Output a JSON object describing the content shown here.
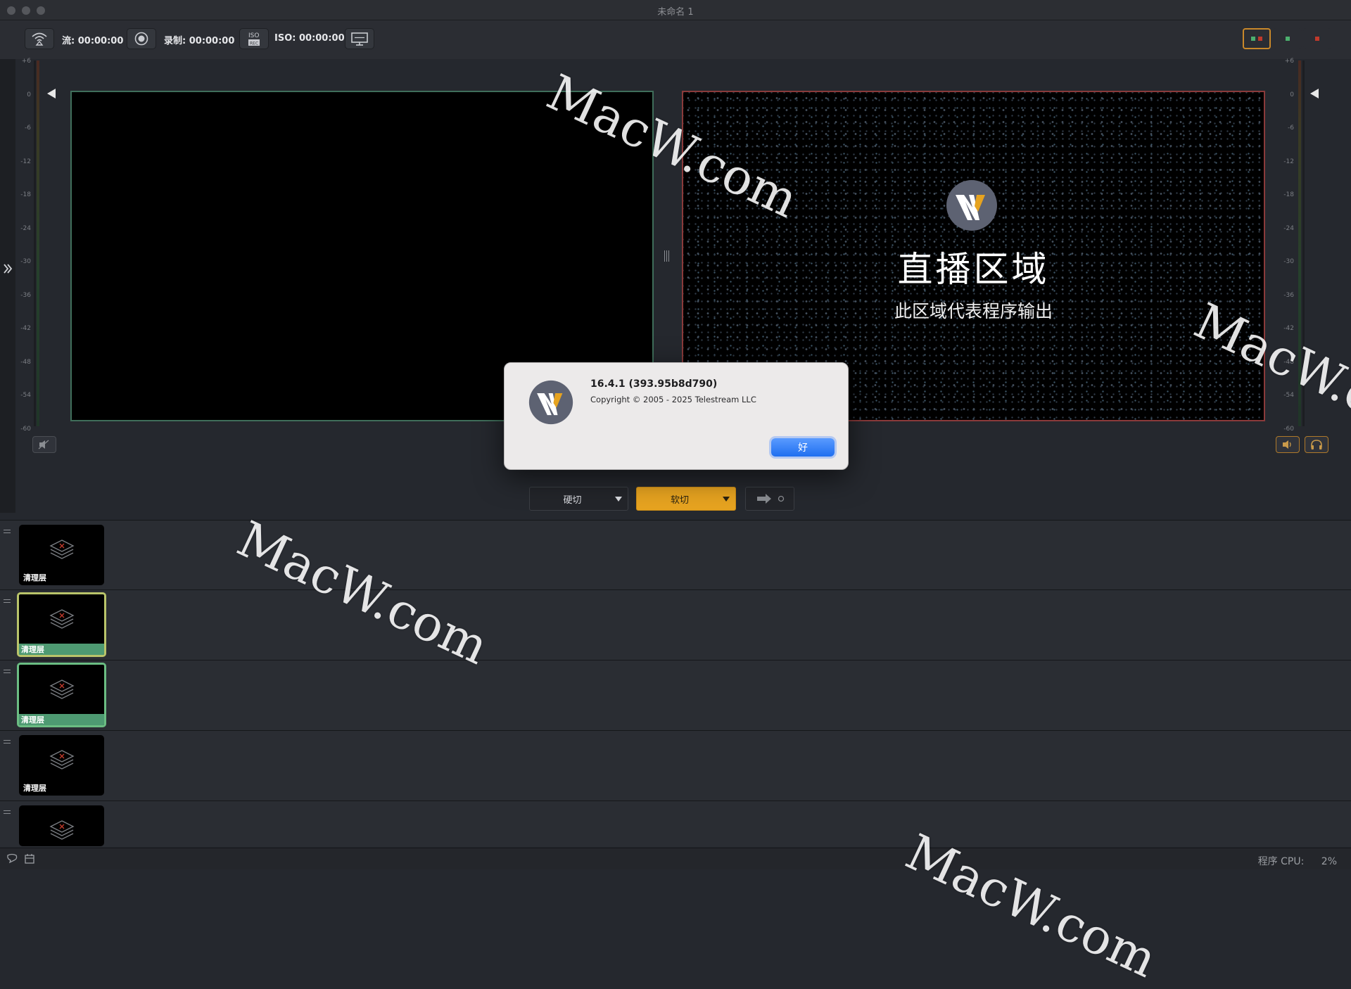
{
  "window": {
    "title": "未命名 1"
  },
  "toolbar": {
    "stream_label": "流: 00:00:00",
    "record_label": "录制: 00:00:00",
    "iso_label": "ISO: 00:00:00"
  },
  "meters": {
    "scale": [
      "+6",
      "0",
      "-6",
      "-12",
      "-18",
      "-24",
      "-30",
      "-36",
      "-42",
      "-48",
      "-54",
      "-60"
    ]
  },
  "live": {
    "title": "直播区域",
    "subtitle": "此区域代表程序输出"
  },
  "transitions": {
    "cut_label": "硬切",
    "smooth_label": "软切"
  },
  "layers": [
    {
      "label": "清理层",
      "active": false
    },
    {
      "label": "清理层",
      "active": true,
      "style": "yellow"
    },
    {
      "label": "清理层",
      "active": true,
      "style": "green"
    },
    {
      "label": "清理层",
      "active": false
    },
    {
      "label": "",
      "active": false
    }
  ],
  "status": {
    "cpu_label": "程序 CPU:",
    "cpu_value": "2%"
  },
  "about": {
    "version": "16.4.1 (393.95b8d790)",
    "copyright": "Copyright © 2005 - 2025 Telestream LLC",
    "ok_label": "好"
  },
  "watermark": "MacW.com",
  "colors": {
    "accent": "#e6a320",
    "live_border": "#8a3a3a",
    "preview_border": "#3f6e5a",
    "active_layer": "#4e9a72"
  }
}
